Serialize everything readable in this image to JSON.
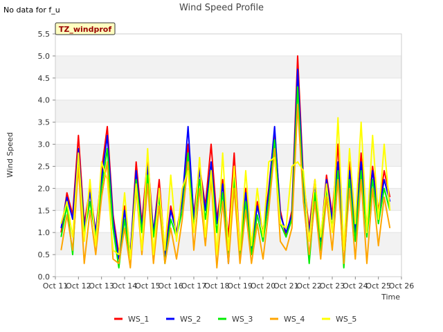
{
  "no_data_note": "No data for f_u",
  "chart_data": {
    "type": "line",
    "title": "Wind Speed Profile",
    "xlabel": "Time",
    "ylabel": "Wind Speed",
    "site_badge": "TZ_windprof",
    "xlim": [
      0,
      15
    ],
    "ylim": [
      0,
      5.5
    ],
    "x_ticks": [
      0,
      1,
      2,
      3,
      4,
      5,
      6,
      7,
      8,
      9,
      10,
      11,
      12,
      13,
      14,
      15
    ],
    "x_tick_labels": [
      "Oct 11",
      "Oct 12",
      "Oct 13",
      "Oct 14",
      "Oct 15",
      "Oct 16",
      "Oct 17",
      "Oct 18",
      "Oct 19",
      "Oct 20",
      "Oct 21",
      "Oct 22",
      "Oct 23",
      "Oct 24",
      "Oct 25",
      "Oct 26"
    ],
    "y_ticks": [
      0,
      0.5,
      1,
      1.5,
      2,
      2.5,
      3,
      3.5,
      4,
      4.5,
      5,
      5.5
    ],
    "y_tick_labels": [
      "0.0",
      "0.5",
      "1.0",
      "1.5",
      "2.0",
      "2.5",
      "3.0",
      "3.5",
      "4.0",
      "4.5",
      "5.0",
      "5.5"
    ],
    "grid": "horizontal bands",
    "legend_position": "bottom",
    "x": [
      0.25,
      0.5,
      0.75,
      1.0,
      1.25,
      1.5,
      1.75,
      2.0,
      2.25,
      2.5,
      2.75,
      3.0,
      3.25,
      3.5,
      3.75,
      4.0,
      4.25,
      4.5,
      4.75,
      5.0,
      5.25,
      5.5,
      5.75,
      6.0,
      6.25,
      6.5,
      6.75,
      7.0,
      7.25,
      7.5,
      7.75,
      8.0,
      8.25,
      8.5,
      8.75,
      9.0,
      9.25,
      9.5,
      9.75,
      10.0,
      10.25,
      10.5,
      10.75,
      11.0,
      11.25,
      11.5,
      11.75,
      12.0,
      12.25,
      12.5,
      12.75,
      13.0,
      13.25,
      13.5,
      13.75,
      14.0,
      14.25,
      14.5
    ],
    "series": [
      {
        "name": "WS_1",
        "color": "#ff0000",
        "values": [
          1.0,
          1.9,
          1.4,
          3.2,
          1.2,
          2.0,
          1.0,
          2.4,
          3.4,
          1.4,
          0.5,
          1.6,
          0.5,
          2.6,
          1.2,
          2.7,
          1.0,
          2.2,
          0.5,
          1.6,
          1.0,
          1.8,
          3.0,
          1.4,
          2.5,
          1.6,
          3.0,
          1.3,
          2.2,
          0.9,
          2.8,
          0.6,
          2.0,
          0.7,
          1.7,
          1.0,
          2.0,
          3.3,
          1.5,
          0.9,
          1.5,
          5.0,
          2.2,
          1.1,
          2.2,
          0.8,
          2.3,
          1.4,
          3.0,
          0.6,
          2.6,
          1.0,
          2.8,
          1.1,
          2.5,
          1.5,
          2.4,
          1.8
        ]
      },
      {
        "name": "WS_2",
        "color": "#0000ff",
        "values": [
          1.1,
          1.8,
          1.3,
          2.9,
          1.1,
          1.9,
          1.0,
          2.2,
          3.2,
          1.3,
          0.4,
          1.5,
          0.5,
          2.4,
          1.1,
          2.5,
          1.0,
          2.0,
          0.4,
          1.5,
          1.0,
          1.7,
          3.4,
          1.3,
          2.4,
          1.5,
          2.6,
          1.2,
          2.1,
          0.3,
          2.4,
          0.6,
          1.9,
          0.6,
          1.6,
          1.0,
          1.9,
          3.4,
          1.4,
          1.0,
          1.4,
          4.7,
          2.1,
          1.0,
          2.1,
          0.8,
          2.2,
          1.3,
          2.6,
          0.6,
          2.4,
          1.0,
          2.6,
          1.1,
          2.4,
          1.4,
          2.2,
          1.7
        ]
      },
      {
        "name": "WS_3",
        "color": "#00ee00",
        "values": [
          0.9,
          1.6,
          0.5,
          2.7,
          1.0,
          1.7,
          0.9,
          2.0,
          2.9,
          1.1,
          0.2,
          1.3,
          0.4,
          2.2,
          1.0,
          2.3,
          0.9,
          1.8,
          0.3,
          1.3,
          0.9,
          1.5,
          2.8,
          1.1,
          2.2,
          1.3,
          2.4,
          1.0,
          1.9,
          0.4,
          2.2,
          0.5,
          1.7,
          0.5,
          1.4,
          0.8,
          1.7,
          3.1,
          1.2,
          0.9,
          1.3,
          4.3,
          1.9,
          0.3,
          1.9,
          0.6,
          2.0,
          1.1,
          2.4,
          0.2,
          2.2,
          0.8,
          2.4,
          0.9,
          2.2,
          1.2,
          2.0,
          1.5
        ]
      },
      {
        "name": "WS_4",
        "color": "#ffa500",
        "values": [
          0.6,
          1.4,
          0.6,
          2.5,
          0.3,
          1.5,
          0.5,
          1.8,
          2.6,
          0.4,
          0.3,
          1.1,
          0.2,
          2.0,
          0.5,
          2.1,
          0.3,
          1.6,
          0.3,
          1.1,
          0.4,
          1.3,
          2.6,
          0.6,
          2.0,
          0.7,
          2.2,
          0.2,
          1.7,
          0.3,
          2.0,
          0.3,
          1.5,
          0.3,
          1.2,
          0.4,
          1.5,
          2.9,
          0.8,
          0.6,
          1.1,
          3.9,
          1.7,
          0.5,
          1.7,
          0.4,
          1.8,
          0.6,
          2.2,
          0.3,
          2.0,
          0.4,
          2.2,
          0.3,
          2.0,
          0.7,
          1.8,
          1.1
        ]
      },
      {
        "name": "WS_5",
        "color": "#ffff00",
        "values": [
          1.2,
          1.7,
          0.9,
          2.8,
          0.8,
          2.2,
          0.7,
          2.6,
          2.2,
          0.6,
          0.5,
          1.9,
          0.4,
          2.1,
          0.6,
          2.9,
          0.5,
          2.0,
          0.6,
          2.3,
          0.8,
          2.0,
          2.4,
          1.0,
          2.7,
          0.9,
          2.4,
          0.5,
          2.8,
          0.6,
          2.5,
          0.6,
          2.4,
          0.7,
          2.0,
          0.9,
          2.6,
          2.7,
          1.2,
          1.1,
          2.5,
          2.6,
          2.4,
          0.8,
          2.2,
          0.9,
          2.1,
          1.0,
          3.6,
          0.6,
          2.9,
          1.2,
          3.5,
          1.0,
          3.2,
          1.3,
          3.0,
          1.5
        ]
      }
    ]
  }
}
